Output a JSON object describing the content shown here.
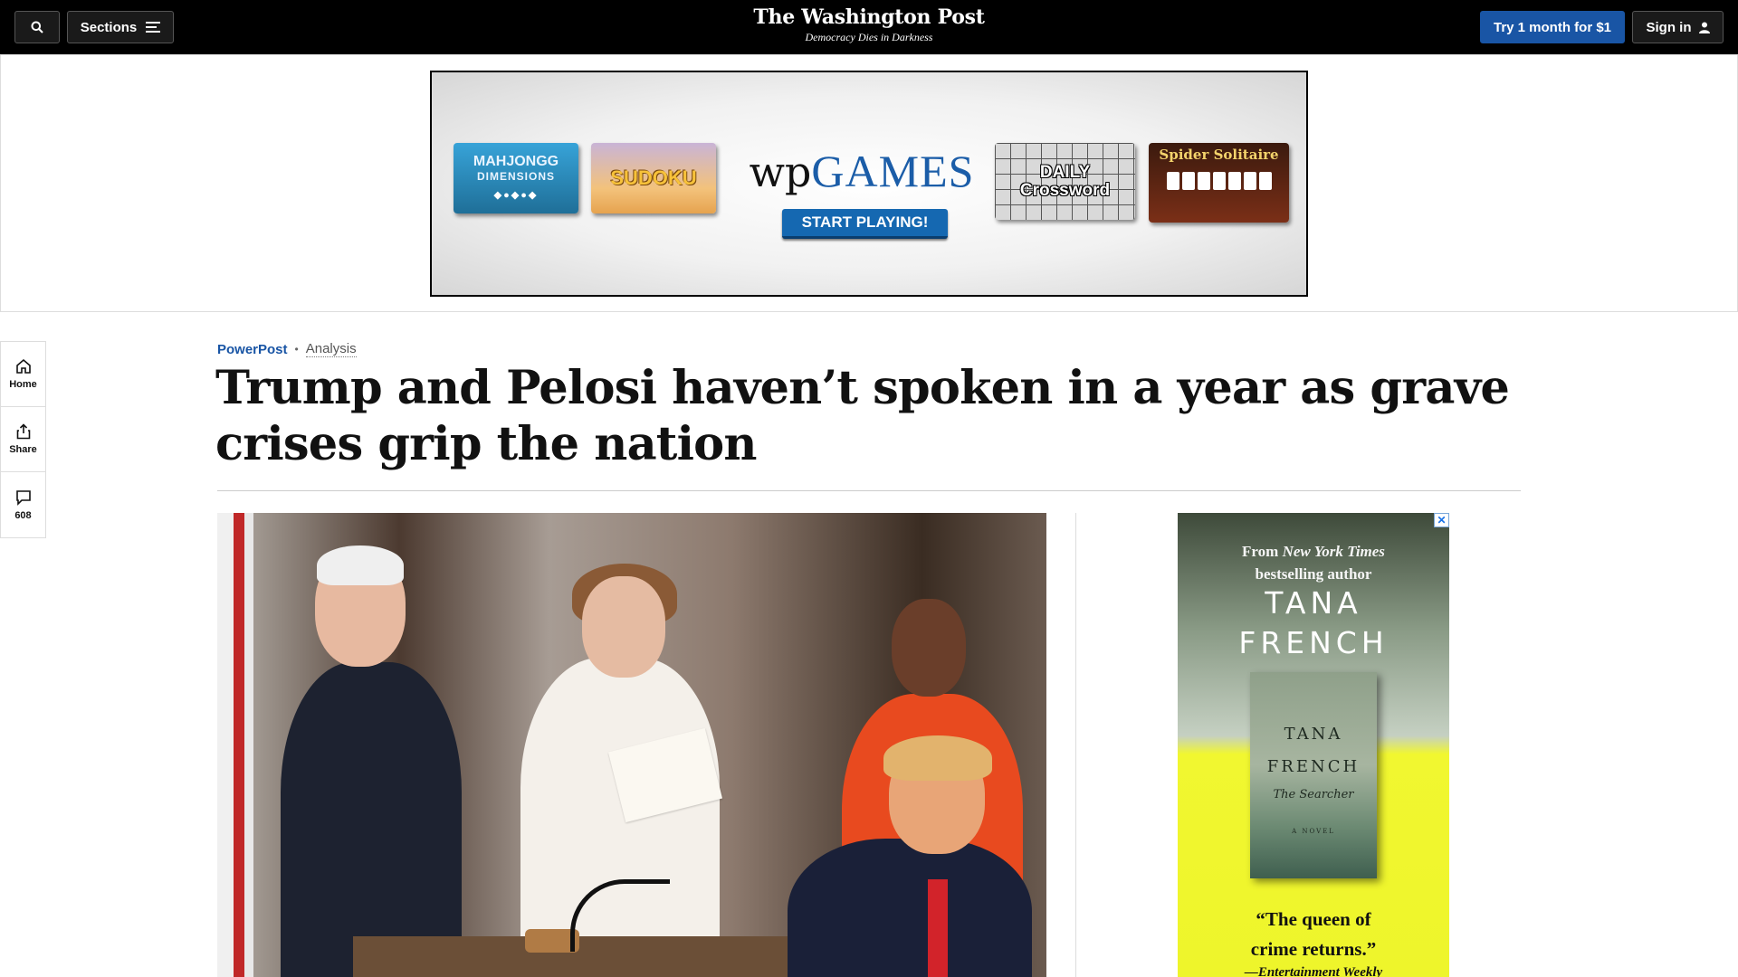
{
  "topbar": {
    "sections_label": "Sections",
    "brand_name": "The Washington Post",
    "tagline": "Democracy Dies in Darkness",
    "subscribe_label": "Try 1 month for $1",
    "signin_label": "Sign in"
  },
  "ad_banner": {
    "tiles": {
      "mahjongg_line1": "MAHJONGG",
      "mahjongg_line2": "DIMENSIONS",
      "sudoku": "SUDOKU",
      "logo_wp": "wp",
      "logo_games": "GAMES",
      "start": "START PLAYING!",
      "crossword_line1": "DAILY",
      "crossword_line2": "Crossword",
      "spider": "Spider Solitaire"
    }
  },
  "rail": {
    "home_label": "Home",
    "share_label": "Share",
    "comments_count": "608"
  },
  "article": {
    "section": "PowerPost",
    "label": "Analysis",
    "headline": "Trump and Pelosi haven’t spoken in a year as grave crises grip the nation"
  },
  "book_ad": {
    "from": "From",
    "publication": "New York Times",
    "bestselling": "bestselling author",
    "author_first": "TANA",
    "author_last": "FRENCH",
    "book_first": "TANA",
    "book_last": "FRENCH",
    "book_title": "The Searcher",
    "book_kind": "A NOVEL",
    "quote_line1": "“The queen of",
    "quote_line2": "crime returns.”",
    "quote_source": "—Entertainment Weekly",
    "adchoice": "✕"
  },
  "colors": {
    "topbar_bg": "#000000",
    "subscribe_bg": "#1955a5",
    "section_link": "#1955a5"
  }
}
